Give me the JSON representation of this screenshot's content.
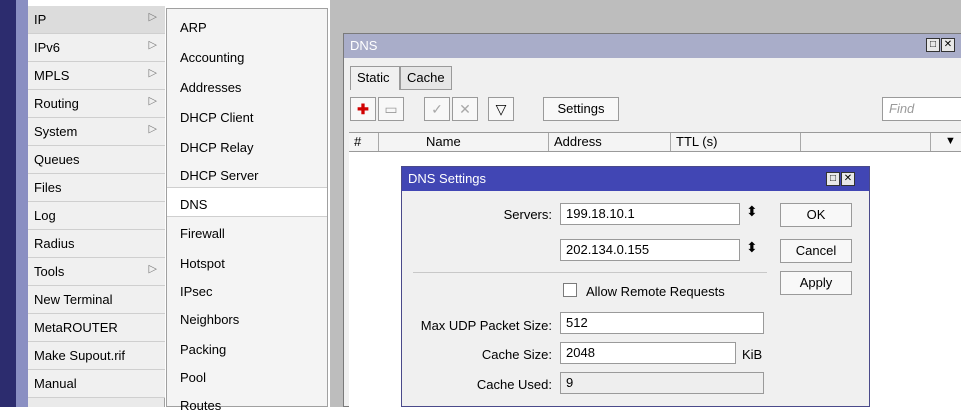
{
  "main_menu": {
    "items": [
      {
        "label": "IP",
        "submenu": true
      },
      {
        "label": "IPv6",
        "submenu": true
      },
      {
        "label": "MPLS",
        "submenu": true
      },
      {
        "label": "Routing",
        "submenu": true
      },
      {
        "label": "System",
        "submenu": true
      },
      {
        "label": "Queues",
        "submenu": false
      },
      {
        "label": "Files",
        "submenu": false
      },
      {
        "label": "Log",
        "submenu": false
      },
      {
        "label": "Radius",
        "submenu": false
      },
      {
        "label": "Tools",
        "submenu": true
      },
      {
        "label": "New Terminal",
        "submenu": false
      },
      {
        "label": "MetaROUTER",
        "submenu": false
      },
      {
        "label": "Make Supout.rif",
        "submenu": false
      },
      {
        "label": "Manual",
        "submenu": false
      }
    ],
    "arrow_glyph": "▷"
  },
  "sub_menu": {
    "items": [
      "ARP",
      "Accounting",
      "Addresses",
      "DHCP Client",
      "DHCP Relay",
      "DHCP Server",
      "DNS",
      "Firewall",
      "Hotspot",
      "IPsec",
      "Neighbors",
      "Packing",
      "Pool",
      "Routes"
    ],
    "selected": "DNS"
  },
  "dns_window": {
    "title": "DNS",
    "tabs": [
      "Static",
      "Cache"
    ],
    "toolbar": {
      "settings_label": "Settings",
      "find_placeholder": "Find",
      "add_icon": "✚",
      "remove_icon": "▭",
      "enable_icon": "✓",
      "disable_icon": "✕",
      "filter_icon": "▽"
    },
    "columns": [
      "#",
      "Name",
      "Address",
      "TTL (s)",
      ""
    ],
    "dropdown_glyph": "▼",
    "maximize_glyph": "□",
    "close_glyph": "✕"
  },
  "dns_settings": {
    "title": "DNS Settings",
    "servers_label": "Servers:",
    "servers": [
      "199.18.10.1",
      "202.134.0.155"
    ],
    "updown_glyph": "⬍",
    "allow_remote_label": "Allow Remote Requests",
    "allow_remote_checked": false,
    "max_udp_label": "Max UDP Packet Size:",
    "max_udp_value": "512",
    "cache_size_label": "Cache Size:",
    "cache_size_value": "2048",
    "cache_size_unit": "KiB",
    "cache_used_label": "Cache Used:",
    "cache_used_value": "9",
    "buttons": {
      "ok": "OK",
      "cancel": "Cancel",
      "apply": "Apply"
    },
    "maximize_glyph": "□",
    "close_glyph": "✕"
  }
}
